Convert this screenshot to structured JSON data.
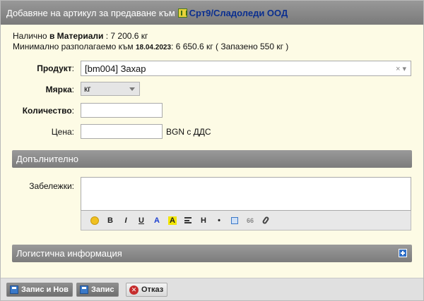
{
  "dialog": {
    "title_prefix": "Добавяне на артикул за предаване към",
    "company": "Срт9/Сладоледи ООД"
  },
  "info": {
    "line1_a": "Налично ",
    "line1_b": "в Материали",
    "line1_c": " : 7 200.6 кг",
    "line2_a": "Минимално разполагаемо към ",
    "line2_date": "18.04.2023",
    "line2_c": ": 6 650.6 кг ( Запазено 550 кг )"
  },
  "form": {
    "product_label": "Продукт",
    "product_value": "[bm004] Захар",
    "product_clear": "×",
    "product_caret": "▾",
    "unit_label": "Мярка",
    "unit_value": "кг",
    "qty_label": "Количество",
    "price_label": "Цена",
    "price_suffix": "BGN с ДДС",
    "colon": ":"
  },
  "sections": {
    "additional": "Допълнително",
    "logistics": "Логистична информация"
  },
  "notes": {
    "label": "Забележки:"
  },
  "toolbar": {
    "bold": "B",
    "italic": "I",
    "underline": "U",
    "color": "A",
    "highlight": "A",
    "heading": "H",
    "bullet": "•",
    "quote": "66"
  },
  "colors": {
    "dialog_bg": "#fdfbe5",
    "header_gray": "#8a8a8a",
    "company_link": "#0b2f8f",
    "text_color_tool": "#1c3fd0",
    "highlight_tool": "#f2e600"
  },
  "footer": {
    "save_new": "Запис и Нов",
    "save": "Запис",
    "cancel": "Отказ"
  }
}
